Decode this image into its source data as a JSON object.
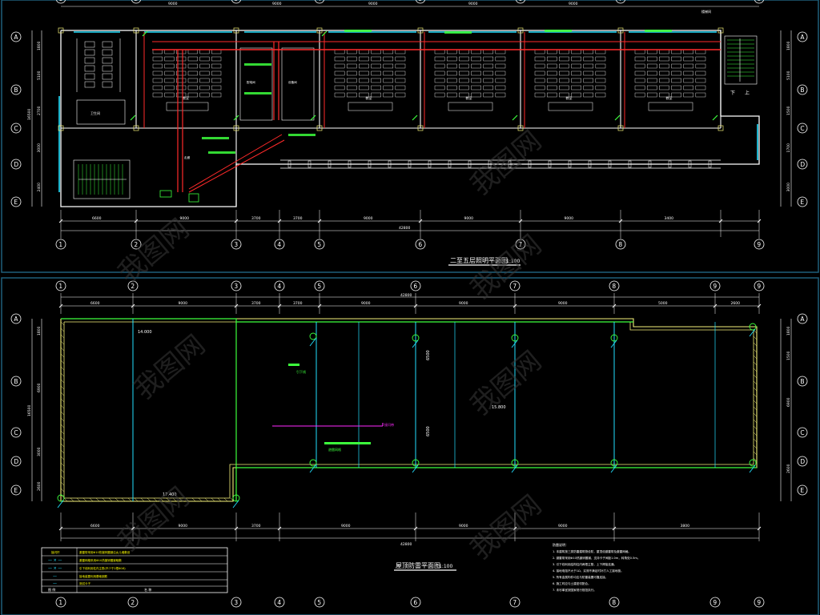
{
  "colors": {
    "background": "#000000",
    "frame": "#1f5f7a",
    "wall": "#ffffff",
    "dim": "#e6e6e6",
    "grid_axis": "#2fd0d6",
    "wire": "#ff2a2a",
    "green": "#3cff3c",
    "yellow": "#f3f07a",
    "cyan": "#22e0ff",
    "magenta": "#ff2aff",
    "watermark": "#3a3a3a"
  },
  "top_plan": {
    "title": "二至五层照明平面图",
    "scale": "1:100",
    "top_dims": [
      "9000",
      "9000",
      "9000",
      "9000",
      "9000"
    ],
    "bottom_dims": [
      "6600",
      "9000",
      "3700",
      "3700",
      "9000",
      "9000",
      "9000",
      "3400"
    ],
    "total_dim": "42800",
    "left_dims": [
      "1800",
      "5100",
      "2700",
      "3000",
      "2400"
    ],
    "left_total": "16500",
    "right_dims": [
      "1800",
      "5100",
      "1500",
      "1700",
      "3000"
    ],
    "axis_bubbles_bottom": [
      "1",
      "2",
      "3",
      "4",
      "5",
      "6",
      "7",
      "8",
      "9"
    ],
    "axis_bubbles_left": [
      "A",
      "B",
      "C",
      "D",
      "E"
    ],
    "notes": [
      "楼梯间",
      "配电间",
      "设备间",
      "走廊",
      "下",
      "上"
    ],
    "room_labels": [
      "卫生间",
      "教室",
      "教室",
      "教室",
      "教室",
      "教室"
    ]
  },
  "bottom_plan": {
    "title": "屋顶防雷平面图",
    "scale": "1:100",
    "top_dims": [
      "6600",
      "9000",
      "3700",
      "3700",
      "9000",
      "9000",
      "9000",
      "5000",
      "2600"
    ],
    "total_dim": "42800",
    "bottom_dims": [
      "6600",
      "9000",
      "3700",
      "9000",
      "9000",
      "9000",
      "3800"
    ],
    "left_dims": [
      "1800",
      "6900",
      "3000",
      "2600"
    ],
    "left_total": "16500",
    "right_dims": [
      "1800",
      "1500",
      "6900",
      "2600"
    ],
    "elev_1": "14.000",
    "elev_2": "15.800",
    "elev_3": "17.400",
    "inner_dims": [
      "6500",
      "6500"
    ],
    "labels": [
      "接闪带",
      "引下线",
      "避雷网格"
    ],
    "legend_header": "图 例",
    "legend_rows": [
      {
        "symbol": "接闪杆",
        "text": "避雷带采用Φ10热镀锌圆钢沿女儿墙敷设"
      },
      {
        "symbol": "— × —",
        "text": "避雷网格采用Φ10热镀锌圆钢暗敷"
      },
      {
        "symbol": "— × —",
        "text": "引下线利用柱内主筋(不少于2根Φ16)"
      },
      {
        "symbol": "—",
        "text": "接地装置利用基础钢筋"
      },
      {
        "symbol": "—",
        "text": "测试卡子"
      }
    ],
    "legend_footer": [
      "图 例",
      "名 称"
    ],
    "notes_title": "防雷说明：",
    "notes": [
      "1. 本建筑按三类防雷建筑物设防，屋顶设避雷带及避雷网格。",
      "2. 避雷带采用Φ10热镀锌圆钢，支持卡子间距1.0m，转角处0.5m。",
      "3. 引下线利用结构柱内两根主筋，上下焊接连通。",
      "4. 接地电阻不大于1Ω，实测不满足时补打人工接地极。",
      "5. 所有金属构件均应与防雷装置可靠连接。",
      "6. 施工时应与土建密切配合。",
      "7. 未尽事宜按国家现行规范执行。"
    ]
  },
  "watermark_text": "我图网"
}
